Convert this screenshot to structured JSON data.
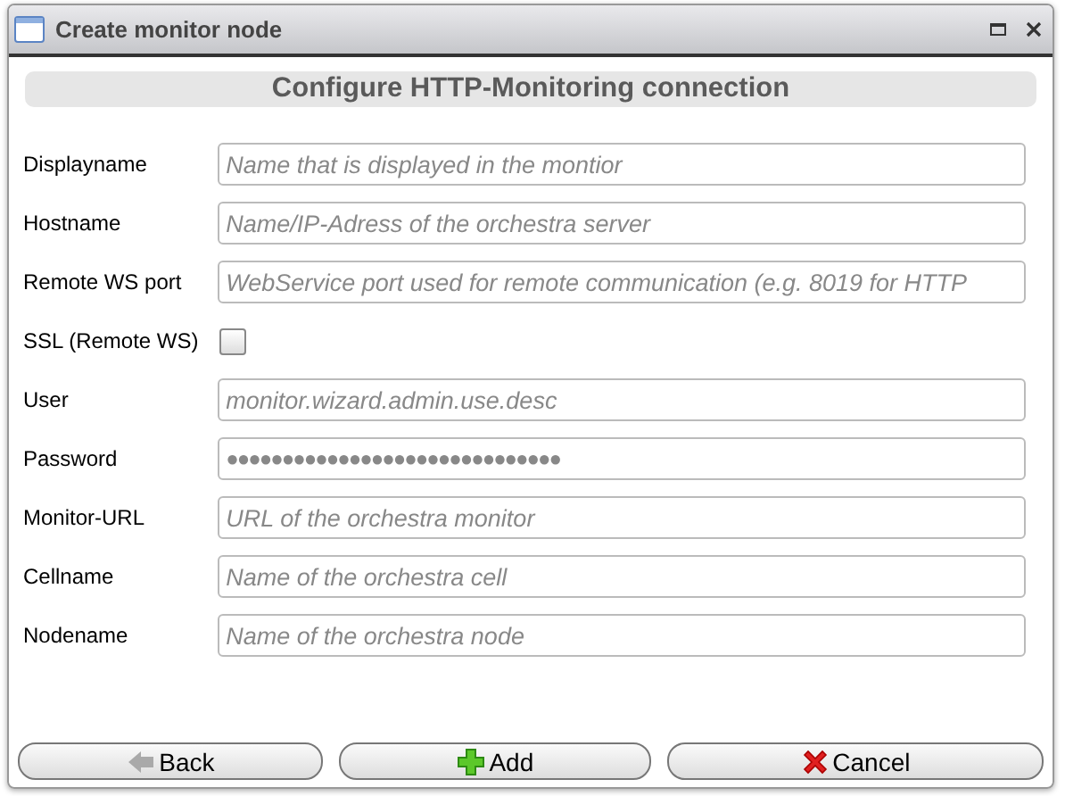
{
  "window": {
    "title": "Create monitor node"
  },
  "heading": "Configure HTTP-Monitoring connection",
  "fields": [
    {
      "kind": "text",
      "label": "Displayname",
      "placeholder": "Name that is displayed in the montior"
    },
    {
      "kind": "text",
      "label": "Hostname",
      "placeholder": "Name/IP-Adress of the orchestra server"
    },
    {
      "kind": "text",
      "label": "Remote WS port",
      "placeholder": "WebService port used for remote communication (e.g. 8019 for HTTP"
    },
    {
      "kind": "checkbox",
      "label": "SSL (Remote WS)",
      "checked": false
    },
    {
      "kind": "text",
      "label": "User",
      "placeholder": "monitor.wizard.admin.use.desc"
    },
    {
      "kind": "password",
      "label": "Password",
      "value": "●●●●●●●●●●●●●●●●●●●●●●●●●●●●●●"
    },
    {
      "kind": "text",
      "label": "Monitor-URL",
      "placeholder": "URL of the orchestra monitor"
    },
    {
      "kind": "text",
      "label": "Cellname",
      "placeholder": "Name of the orchestra cell"
    },
    {
      "kind": "text",
      "label": "Nodename",
      "placeholder": "Name of the orchestra node"
    }
  ],
  "buttons": [
    {
      "kind": "back",
      "label": "Back"
    },
    {
      "kind": "add",
      "label": "Add"
    },
    {
      "kind": "cancel",
      "label": "Cancel"
    }
  ]
}
